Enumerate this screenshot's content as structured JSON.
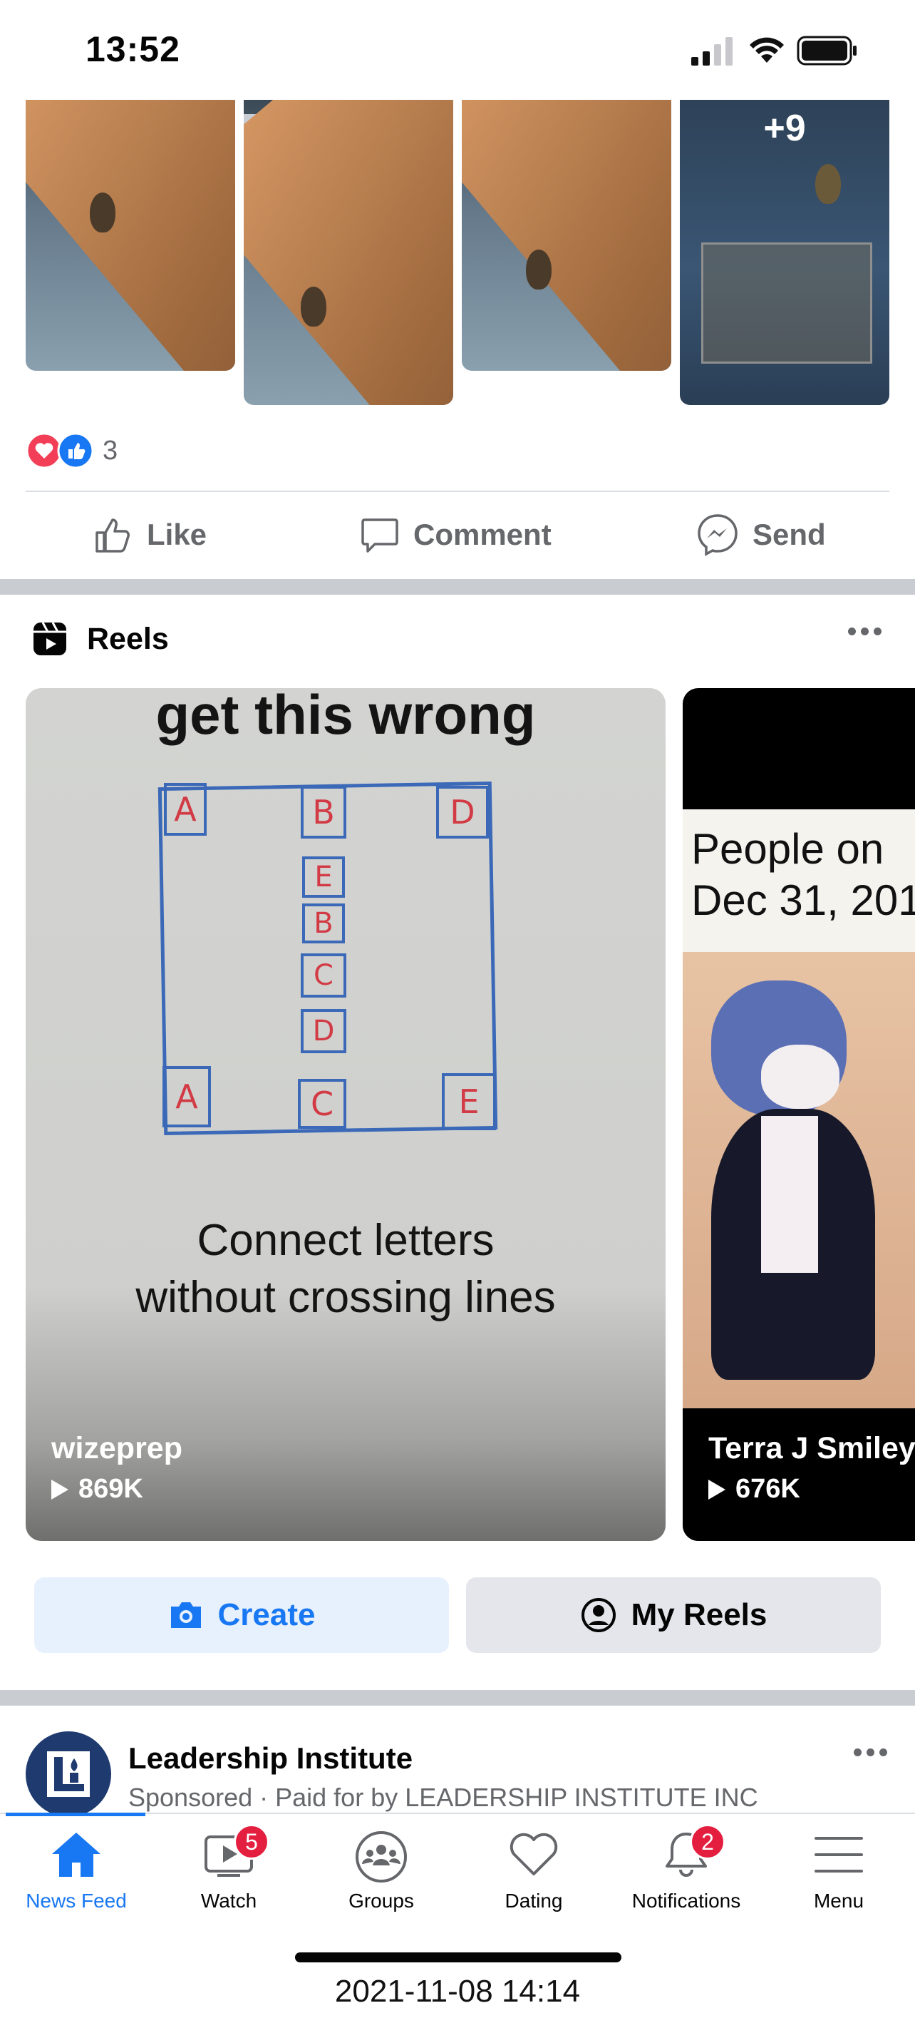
{
  "status_bar": {
    "time": "13:52"
  },
  "post": {
    "photo_overflow": "+9",
    "reaction_count": "3",
    "actions": {
      "like": "Like",
      "comment": "Comment",
      "send": "Send"
    }
  },
  "reels": {
    "section_title": "Reels",
    "cards": [
      {
        "overlay_top": "get this wrong",
        "caption_line1": "Connect letters",
        "caption_line2": "without crossing lines",
        "author": "wizeprep",
        "views": "869K"
      },
      {
        "overlay_line1": "People on",
        "overlay_line2": "Dec 31, 201",
        "author": "Terra J Smiley",
        "views": "676K"
      }
    ],
    "puzzle_letters": {
      "a1": "A",
      "b1": "B",
      "d1": "D",
      "e1": "E",
      "b2": "B",
      "c1": "C",
      "d2": "D",
      "a2": "A",
      "c2": "C",
      "e2": "E"
    },
    "create_button": "Create",
    "my_reels_button": "My Reels"
  },
  "sponsored": {
    "name": "Leadership Institute",
    "subtitle": "Sponsored · Paid for by LEADERSHIP INSTITUTE INC"
  },
  "bottom_nav": {
    "items": [
      {
        "label": "News Feed",
        "active": true
      },
      {
        "label": "Watch",
        "badge": "5"
      },
      {
        "label": "Groups"
      },
      {
        "label": "Dating"
      },
      {
        "label": "Notifications",
        "badge": "2"
      },
      {
        "label": "Menu"
      }
    ]
  },
  "footer_timestamp": "2021-11-08 14:14",
  "colors": {
    "brand_blue": "#1877f2",
    "badge_red": "#e41e3f",
    "divider": "#c9ccd1"
  }
}
